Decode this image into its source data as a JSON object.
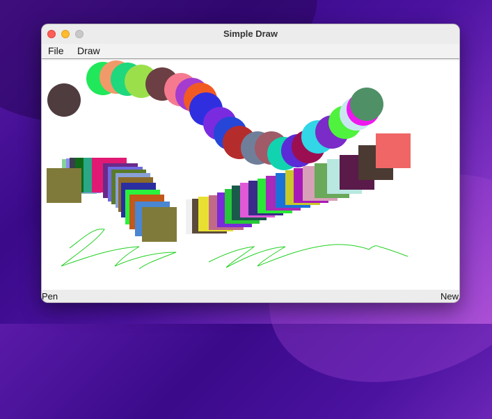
{
  "window": {
    "title": "Simple Draw"
  },
  "menu": {
    "file": "File",
    "draw": "Draw"
  },
  "status": {
    "tool": "Pen",
    "action": "New"
  },
  "colors": {
    "circles": [
      "#4f3c3f",
      "#20e85a",
      "#f09a6a",
      "#1fd77c",
      "#9be04b",
      "#6b3f43",
      "#f57a8f",
      "#a53cd0",
      "#f25a23",
      "#2f2fe0",
      "#7a2be0",
      "#2646d8",
      "#b52c2c",
      "#6f7f9a",
      "#a05a68",
      "#12d3b0",
      "#5a2bd6",
      "#9b0f52",
      "#32d6e6",
      "#7a2bc8",
      "#4ff23c",
      "#c9e6f0",
      "#ee18ee",
      "#4f9066"
    ],
    "squares_left": [
      "#86d19a",
      "#8c8cf0",
      "#3a3e4e",
      "#0f6a18",
      "#2aa886",
      "#e01a74",
      "#6a2a8a",
      "#6f6ae2",
      "#5a7a2a",
      "#8aa0d8",
      "#8a6a2a",
      "#2a2ea0",
      "#2af23c",
      "#c2581a",
      "#4a86d2",
      "#807a3a"
    ],
    "squares_right": [
      "#f0f0f0",
      "#5a4a3a",
      "#e8e030",
      "#c06a88",
      "#7a2ad8",
      "#28c838",
      "#1a5a4a",
      "#e05ad8",
      "#3a2a8a",
      "#2ae838",
      "#a82ab8",
      "#1a72d8",
      "#c8c82a",
      "#a818b8",
      "#d8a0b8",
      "#6aa85a",
      "#b8e8e0",
      "#5a1a4a",
      "#4a3a32",
      "#f06666"
    ],
    "stroke": "#1fd01f"
  }
}
